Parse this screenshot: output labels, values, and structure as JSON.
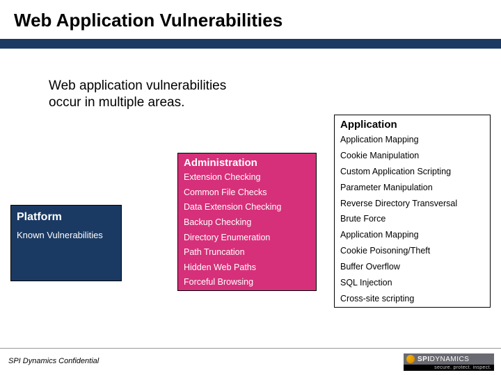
{
  "title": "Web Application Vulnerabilities",
  "subtitle_line1": "Web application vulnerabilities",
  "subtitle_line2": "occur in multiple areas.",
  "platform": {
    "title": "Platform",
    "items": [
      "Known Vulnerabilities"
    ]
  },
  "administration": {
    "title": "Administration",
    "items": [
      "Extension Checking",
      "Common File Checks",
      "Data Extension Checking",
      "Backup Checking",
      "Directory Enumeration",
      "Path Truncation",
      "Hidden Web Paths",
      "Forceful Browsing"
    ]
  },
  "application": {
    "title": "Application",
    "items": [
      "Application Mapping",
      "Cookie Manipulation",
      "Custom Application Scripting",
      "Parameter Manipulation",
      "Reverse Directory Transversal",
      "Brute Force",
      "Application Mapping",
      "Cookie Poisoning/Theft",
      "Buffer Overflow",
      "SQL Injection",
      "Cross-site scripting"
    ]
  },
  "footer": {
    "confidential": "SPI Dynamics Confidential",
    "logo_brand_prefix": "SPI",
    "logo_brand_suffix": "DYNAMICS",
    "logo_tagline": "secure. protect. inspect."
  }
}
